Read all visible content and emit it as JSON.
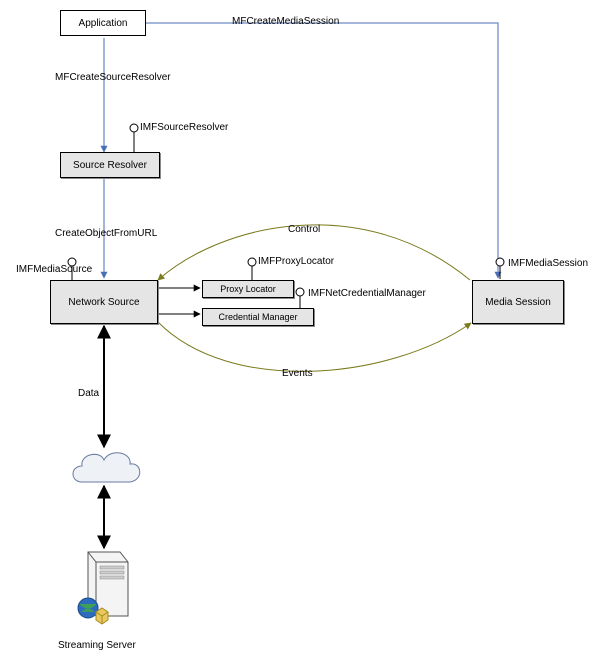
{
  "nodes": {
    "application": "Application",
    "source_resolver": "Source Resolver",
    "network_source": "Network Source",
    "proxy_locator": "Proxy Locator",
    "credential_manager": "Credential Manager",
    "media_session": "Media Session",
    "streaming_server": "Streaming Server"
  },
  "edge_labels": {
    "mfcreate_media_session": "MFCreateMediaSession",
    "mfcreate_source_resolver": "MFCreateSourceResolver",
    "create_object_from_url": "CreateObjectFromURL",
    "control": "Control",
    "events": "Events",
    "data": "Data"
  },
  "interfaces": {
    "imf_source_resolver": "IMFSourceResolver",
    "imf_media_source": "IMFMediaSource",
    "imf_proxy_locator": "IMFProxyLocator",
    "imf_net_credential_manager": "IMFNetCredentialManager",
    "imf_media_session": "IMFMediaSession"
  }
}
